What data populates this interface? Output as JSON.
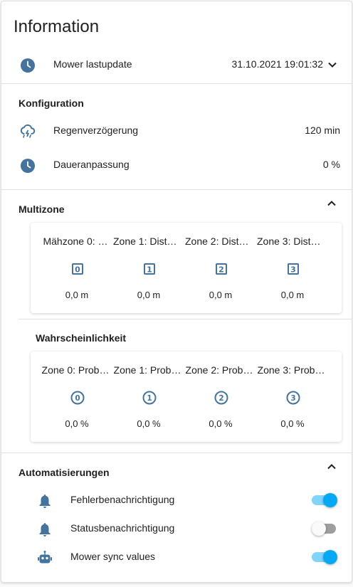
{
  "card": {
    "title": "Information",
    "lastupdate": {
      "label": "Mower lastupdate",
      "value": "31.10.2021 19:01:32",
      "icon": "clock-icon"
    }
  },
  "konfiguration": {
    "title": "Konfiguration",
    "rows": [
      {
        "label": "Regenverzögerung",
        "value": "120 min",
        "icon": "rain-lightning-icon"
      },
      {
        "label": "Daueranpassung",
        "value": "0 %",
        "icon": "clock-icon"
      }
    ]
  },
  "multizone": {
    "title": "Multizone",
    "distances": [
      {
        "name": "Mähzone 0: …",
        "icon": "numeric-0-box-icon",
        "glyph": "0",
        "value": "0,0 m"
      },
      {
        "name": "Zone 1: Dista…",
        "icon": "numeric-1-box-icon",
        "glyph": "1",
        "value": "0,0 m"
      },
      {
        "name": "Zone 2: Dista…",
        "icon": "numeric-2-box-icon",
        "glyph": "2",
        "value": "0,0 m"
      },
      {
        "name": "Zone 3: Dista…",
        "icon": "numeric-3-box-icon",
        "glyph": "3",
        "value": "0,0 m"
      }
    ],
    "probability_title": "Wahrscheinlichkeit",
    "probabilities": [
      {
        "name": "Zone 0: Prob…",
        "icon": "numeric-0-circle-icon",
        "glyph": "0",
        "value": "0,0 %"
      },
      {
        "name": "Zone 1: Prob…",
        "icon": "numeric-1-circle-icon",
        "glyph": "1",
        "value": "0,0 %"
      },
      {
        "name": "Zone 2: Prob…",
        "icon": "numeric-2-circle-icon",
        "glyph": "2",
        "value": "0,0 %"
      },
      {
        "name": "Zone 3: Prob…",
        "icon": "numeric-3-circle-icon",
        "glyph": "3",
        "value": "0,0 %"
      }
    ]
  },
  "automatisierungen": {
    "title": "Automatisierungen",
    "items": [
      {
        "label": "Fehlerbenachrichtigung",
        "icon": "bell-icon",
        "on": true
      },
      {
        "label": "Statusbenachrichtigung",
        "icon": "bell-icon",
        "on": false
      },
      {
        "label": "Mower sync values",
        "icon": "robot-icon",
        "on": true
      }
    ]
  },
  "colors": {
    "icon": "#44739e",
    "toggle_on_knob": "#03a9f4",
    "toggle_on_track": "#81d4fa",
    "toggle_off_knob": "#fafafa",
    "toggle_off_track": "#9e9e9e"
  }
}
